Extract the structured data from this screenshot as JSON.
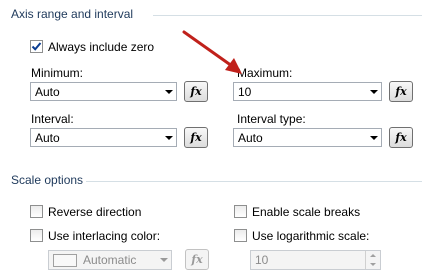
{
  "axis_range": {
    "title": "Axis range and interval",
    "always_include_zero": {
      "label": "Always include zero",
      "checked": true
    },
    "minimum": {
      "label": "Minimum:",
      "value": "Auto"
    },
    "maximum": {
      "label": "Maximum:",
      "value": "10"
    },
    "interval": {
      "label": "Interval:",
      "value": "Auto"
    },
    "interval_type": {
      "label": "Interval type:",
      "value": "Auto"
    },
    "fx_label": "fx"
  },
  "scale_options": {
    "title": "Scale options",
    "reverse_direction": {
      "label": "Reverse direction",
      "checked": false
    },
    "enable_scale_breaks": {
      "label": "Enable scale breaks",
      "checked": false
    },
    "use_interlacing_color": {
      "label": "Use interlacing color:",
      "checked": false
    },
    "use_logarithmic_scale": {
      "label": "Use logarithmic scale:",
      "checked": false
    },
    "interlacing_color_value": "Automatic",
    "log_base_value": "10"
  },
  "annotation": {
    "arrow_color": "#c0211b"
  },
  "colors": {
    "section_title": "#1e395b",
    "checkbox_check": "#0b3d91"
  }
}
